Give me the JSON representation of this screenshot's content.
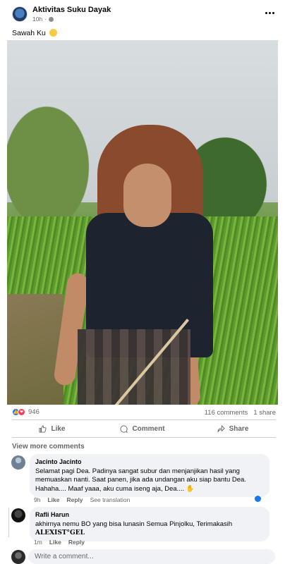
{
  "post": {
    "page_name": "Aktivitas Suku Dayak",
    "time": "10h",
    "privacy_icon": "globe-icon",
    "caption": "Sawah Ku",
    "caption_emoji": "grinning-face-emoji"
  },
  "stats": {
    "reaction_count": "946",
    "reactions": [
      "like",
      "love"
    ],
    "comments": "116 comments",
    "shares": "1 share"
  },
  "actions": {
    "like": "Like",
    "comment": "Comment",
    "share": "Share"
  },
  "comments_section": {
    "view_more": "View more comments",
    "comments": [
      {
        "author": "Jacinto Jacinto",
        "text": "Selamat pagi Dea. Padinya sangat subur dan menjanjikan hasil yang memuaskan nanti. Saat panen, jika ada undangan aku siap bantu Dea. Hahaha.... Maaf yaaa, aku cuma iseng aja, Dea....",
        "text_emoji": "waving-hand-emoji",
        "time": "9h",
        "like": "Like",
        "reply": "Reply",
        "translate": "See translation",
        "reaction": "like"
      },
      {
        "author": "Rafli Harun",
        "text": "akhirnya nemu BO yang bisa lunasin Semua Pinjolku, Terimakasih",
        "text_line2": "ALEXIST°GEL",
        "time": "1m",
        "like": "Like",
        "reply": "Reply"
      }
    ],
    "write_placeholder": "Write a comment..."
  },
  "colors": {
    "accent": "#1877f2",
    "love": "#f33e58",
    "bubble": "#f0f2f5",
    "muted_text": "#65676b"
  }
}
